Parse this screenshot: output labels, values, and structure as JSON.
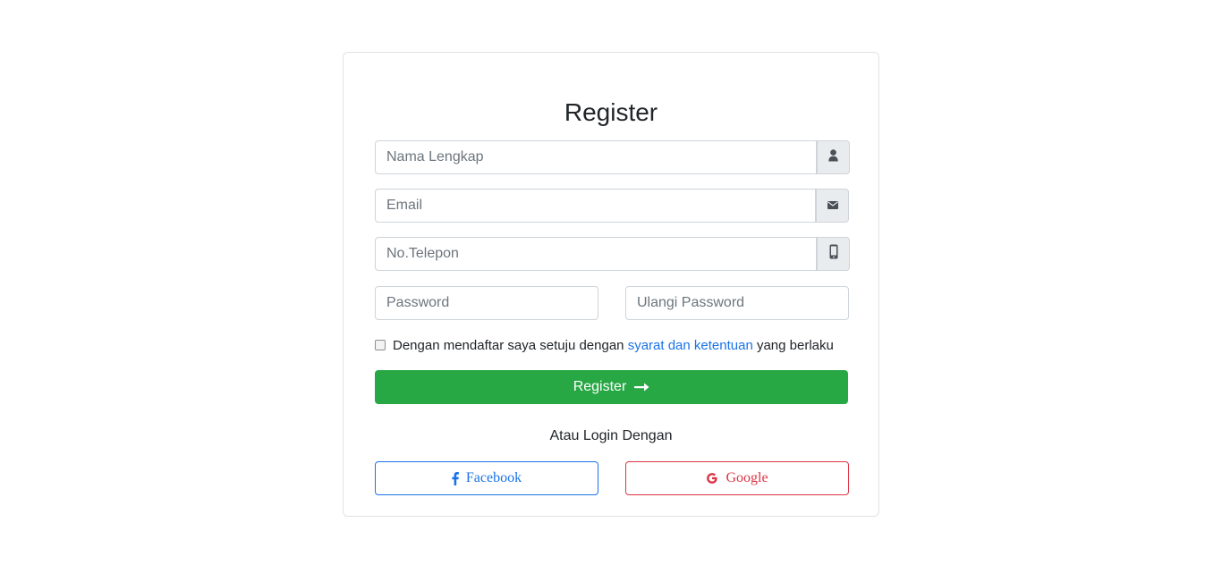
{
  "form": {
    "title": "Register",
    "fields": {
      "full_name_placeholder": "Nama Lengkap",
      "email_placeholder": "Email",
      "phone_placeholder": "No.Telepon",
      "password_placeholder": "Password",
      "confirm_password_placeholder": "Ulangi Password"
    },
    "terms": {
      "prefix": "Dengan mendaftar saya setuju dengan",
      "link_text": "syarat dan ketentuan",
      "suffix": "yang berlaku"
    },
    "register_button_label": "Register",
    "alt_login_text": "Atau Login Dengan",
    "facebook_label": "Facebook",
    "google_label": "Google"
  },
  "icons": {
    "full_name": "user-icon",
    "email": "envelope-icon",
    "phone": "mobile-phone-icon",
    "register": "arrow-right-icon",
    "facebook": "facebook-icon",
    "google": "google-icon"
  },
  "colors": {
    "primary": "#1a73e8",
    "success": "#28a745",
    "danger": "#dc3545"
  }
}
